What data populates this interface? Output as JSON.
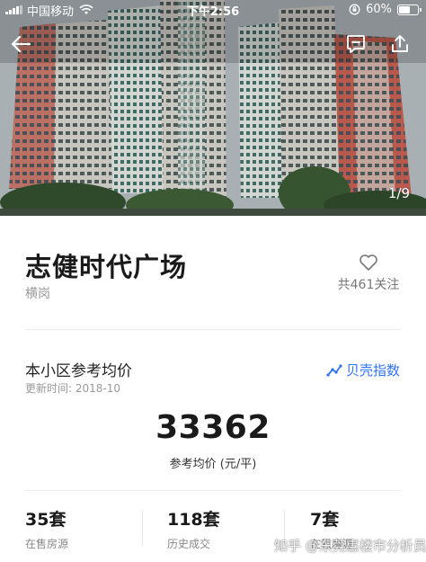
{
  "status_bar": {
    "carrier": "中国移动",
    "time": "下午2:56",
    "battery_text": "60%",
    "battery_level": 0.6
  },
  "gallery": {
    "indicator": "1/9"
  },
  "community": {
    "name": "志健时代广场",
    "district": "横岗",
    "follow_text": "共461关注"
  },
  "reference_price": {
    "title": "本小区参考均价",
    "update_time": "更新时间: 2018-10",
    "index_link": "贝壳指数",
    "value": "33362",
    "unit_label": "参考均价 (元/平)"
  },
  "stats": [
    {
      "value": "35套",
      "label": "在售房源"
    },
    {
      "value": "118套",
      "label": "历史成交"
    },
    {
      "value": "7套",
      "label": "在租房源"
    }
  ],
  "watermark": "知乎 @东莞惠楼市分析员",
  "icons": {
    "back": "arrow-left-icon",
    "message": "message-icon",
    "share": "share-icon",
    "follow": "heart-icon",
    "index": "trend-chart-icon"
  },
  "colors": {
    "accent": "#3072f6",
    "title": "#1a1a1a",
    "muted": "#999999"
  }
}
